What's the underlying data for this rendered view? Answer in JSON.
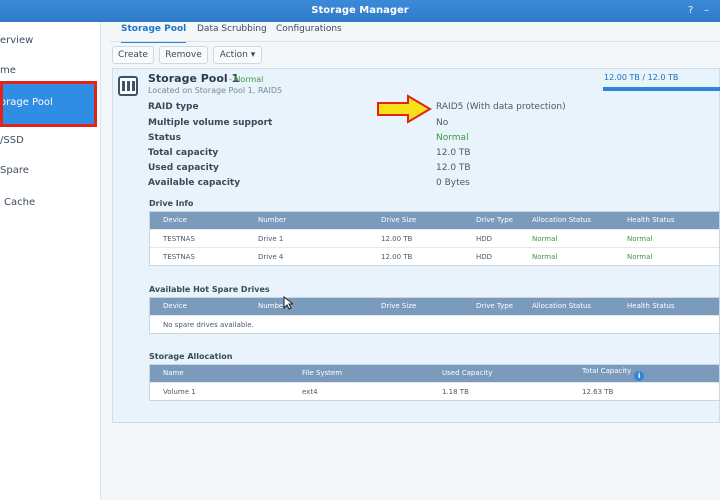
{
  "window": {
    "title": "Storage Manager",
    "help_glyph": "?",
    "min_glyph": "–"
  },
  "sidebar": {
    "items": [
      {
        "label": "Overview",
        "visible": "erview"
      },
      {
        "label": "Volume",
        "visible": "me"
      },
      {
        "label": "Storage Pool",
        "visible": "orage Pool"
      },
      {
        "label": "HDD/SSD",
        "visible": "/SSD"
      },
      {
        "label": "Hot Spare",
        "visible": "Spare"
      },
      {
        "label": "SSD Cache",
        "visible": "Cache"
      }
    ]
  },
  "tabs": [
    {
      "label": "Storage Pool",
      "active": true
    },
    {
      "label": "Data Scrubbing",
      "active": false
    },
    {
      "label": "Configurations",
      "active": false
    }
  ],
  "toolbar": {
    "create": "Create",
    "remove": "Remove",
    "action": "Action ▾"
  },
  "pool": {
    "name": "Storage Pool 1",
    "status": "- Normal",
    "location": "Located on Storage Pool 1, RAID5",
    "usage_text": "12.00 TB / 12.0  TB",
    "usage_fraction": 1.0
  },
  "properties": [
    {
      "label": "RAID type",
      "value": "RAID5  (With data protection)",
      "status": false
    },
    {
      "label": "Multiple volume support",
      "value": "No",
      "status": false
    },
    {
      "label": "Status",
      "value": "Normal",
      "status": true
    },
    {
      "label": "Total capacity",
      "value": "12.0  TB",
      "status": false
    },
    {
      "label": "Used capacity",
      "value": "12.0  TB",
      "status": false
    },
    {
      "label": "Available capacity",
      "value": "0 Bytes",
      "status": false
    }
  ],
  "drive_info": {
    "title": "Drive Info",
    "headers": [
      "Device",
      "Number",
      "Drive Size",
      "Drive Type",
      "Allocation Status",
      "Health Status"
    ],
    "rows": [
      [
        "TESTNAS",
        "Drive 1",
        "12.00 TB",
        "HDD",
        "Normal",
        "Normal"
      ],
      [
        "TESTNAS",
        "Drive 4",
        "12.00 TB",
        "HDD",
        "Normal",
        "Normal"
      ]
    ]
  },
  "hot_spare": {
    "title": "Available Hot Spare Drives",
    "headers": [
      "Device",
      "Number",
      "Drive Size",
      "Drive Type",
      "Allocation Status",
      "Health Status"
    ],
    "empty": "No spare drives available."
  },
  "storage_allocation": {
    "title": "Storage Allocation",
    "headers": [
      "Name",
      "File System",
      "Used Capacity",
      "Total Capacity"
    ],
    "info_glyph": "i",
    "rows": [
      [
        "Volume 1",
        "ext4",
        "1.18 TB",
        "12.63 TB"
      ]
    ]
  },
  "colors": {
    "accent": "#2f8de4",
    "annotation_arrow": "#f5e01a",
    "annotation_box": "#e2231a",
    "normal": "#3a9a3a"
  }
}
